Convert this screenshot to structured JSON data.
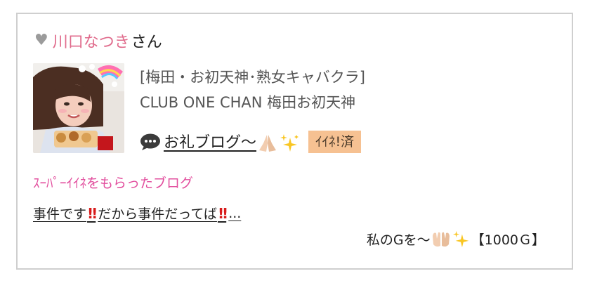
{
  "header": {
    "name": "川口なつき",
    "suffix": "さん",
    "icon": "heart-icon"
  },
  "shop": {
    "category": "[梅田・お初天神･熟女キャバクラ]",
    "name": "CLUB ONE CHAN 梅田お初天神"
  },
  "blog": {
    "title": "お礼ブログ〜",
    "badge": "ｲｲﾈ!済",
    "icon": "speech-bubble-icon"
  },
  "super_like": {
    "heading": "ｽｰﾊﾟｰｲｲﾈをもらったブログ"
  },
  "items": [
    {
      "part1": "事件です",
      "part2": "だから事件だってば",
      "part3": "..."
    },
    {
      "text": "私のGを〜",
      "price": "【1000Ｇ】"
    }
  ],
  "colors": {
    "accent_pink": "#e06b8c",
    "heading_pink": "#e24f9e",
    "badge_bg": "#f6c192",
    "border": "#cfcfcf"
  }
}
